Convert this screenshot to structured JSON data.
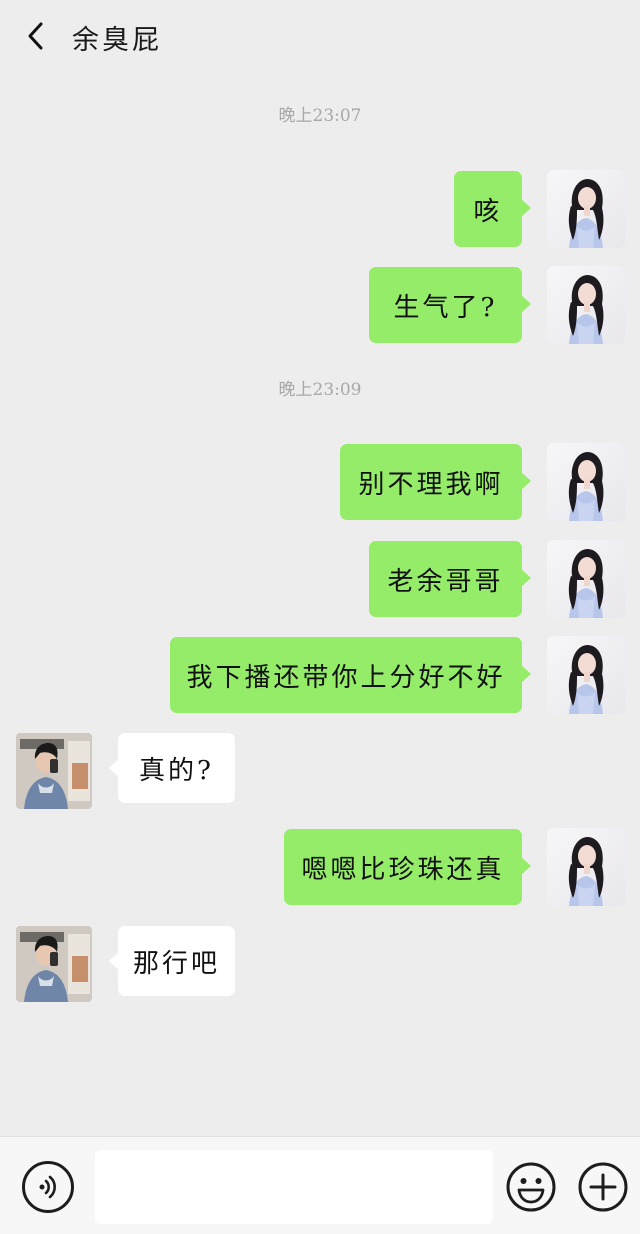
{
  "header": {
    "title": "余臭屁",
    "back_icon": "chevron-left-icon"
  },
  "timestamps": [
    "晚上23:07",
    "晚上23:09"
  ],
  "messages": [
    {
      "sender": "me",
      "text": "咳"
    },
    {
      "sender": "me",
      "text": "生气了?"
    },
    {
      "sender": "me",
      "text": "别不理我啊"
    },
    {
      "sender": "me",
      "text": "老余哥哥"
    },
    {
      "sender": "me",
      "text": "我下播还带你上分好不好"
    },
    {
      "sender": "other",
      "text": "真的?"
    },
    {
      "sender": "me",
      "text": "嗯嗯比珍珠还真"
    },
    {
      "sender": "other",
      "text": "那行吧"
    }
  ],
  "input_bar": {
    "voice_icon": "voice-icon",
    "input_value": "",
    "emoji_icon": "emoji-icon",
    "plus_icon": "plus-icon"
  },
  "colors": {
    "background": "#ededed",
    "my_bubble": "#95ec69",
    "other_bubble": "#ffffff",
    "timestamp_text": "#a8a8a8"
  }
}
